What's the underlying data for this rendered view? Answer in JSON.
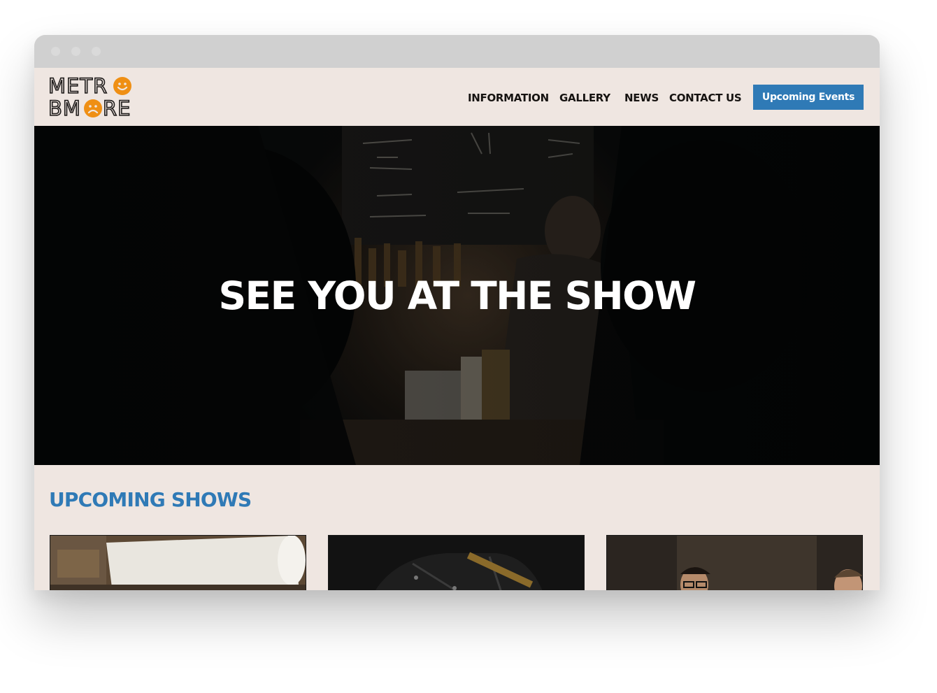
{
  "brand": {
    "logo_line1": "METR",
    "logo_line2_a": "BM",
    "logo_line2_b": "RE",
    "accent": "#ef8f14"
  },
  "nav": {
    "items": [
      "INFORMATION",
      "GALLERY",
      "NEWS",
      "CONTACT US"
    ],
    "cta_label": "Upcoming Events",
    "cta_color": "#2f7ab6"
  },
  "hero": {
    "title": "SEE YOU AT THE SHOW"
  },
  "upcoming": {
    "title": "UPCOMING SHOWS",
    "cards": [
      {
        "image": "event-photo-1"
      },
      {
        "image": "event-photo-2"
      },
      {
        "image": "event-photo-3"
      }
    ]
  },
  "colors": {
    "page_bg": "#efe6e1",
    "section_title": "#2f7ab6"
  }
}
